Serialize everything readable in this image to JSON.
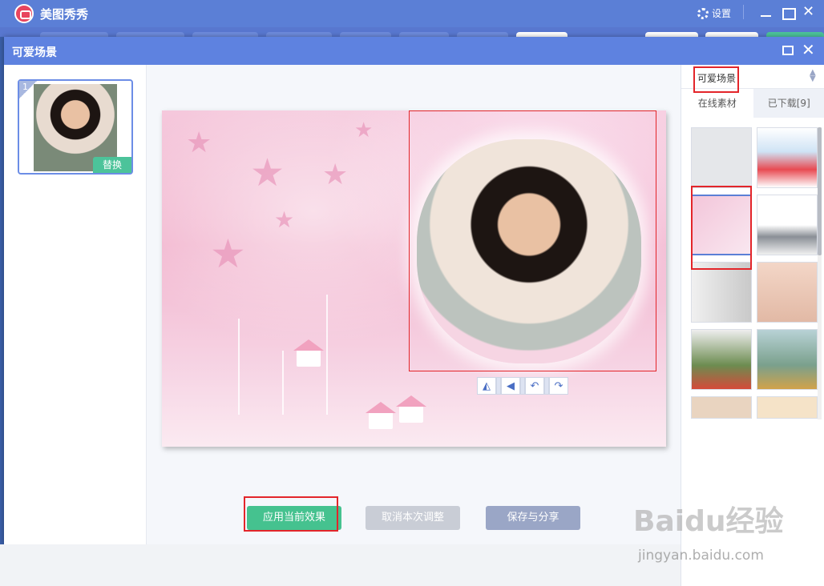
{
  "app": {
    "title": "美图秀秀",
    "settings_label": "设置"
  },
  "dialog": {
    "title": "可爱场景"
  },
  "thumbnail": {
    "index": "1",
    "replace_label": "替换"
  },
  "toolbar": {
    "flip_h": "◭",
    "flip_v": "◀",
    "rotate_left": "↶",
    "rotate_right": "↷"
  },
  "buttons": {
    "apply": "应用当前效果",
    "cancel": "取消本次调整",
    "save": "保存与分享"
  },
  "right_panel": {
    "category": "可爱场景",
    "tabs": [
      {
        "label": "在线素材"
      },
      {
        "label": "已下载[9]"
      }
    ]
  },
  "watermark": {
    "brand": "Baidu经验",
    "url": "jingyan.baidu.com"
  },
  "colors": {
    "accent": "#5e82e0",
    "apply_green": "#45c28f",
    "highlight_red": "#e3252a"
  }
}
